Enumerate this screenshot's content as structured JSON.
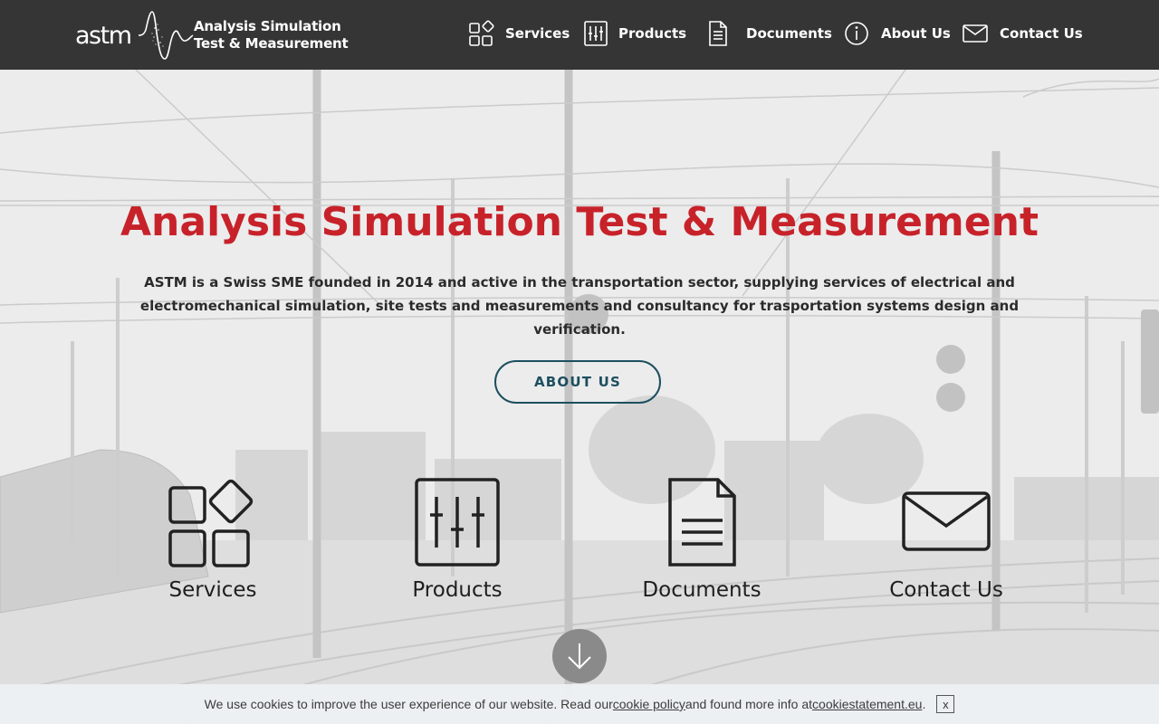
{
  "header": {
    "logo_word": "astm",
    "tagline_line1": "Analysis Simulation",
    "tagline_line2": "Test & Measurement",
    "nav": [
      {
        "label": "Services",
        "icon": "services-grid-icon"
      },
      {
        "label": "Products",
        "icon": "sliders-icon"
      },
      {
        "label": "Documents",
        "icon": "document-icon"
      },
      {
        "label": "About Us",
        "icon": "info-icon"
      },
      {
        "label": "Contact Us",
        "icon": "envelope-icon"
      }
    ]
  },
  "hero": {
    "title": "Analysis Simulation Test & Measurement",
    "description": "ASTM is a Swiss SME founded in 2014 and active in the transportation sector, supplying services of electrical and electromechanical simulation, site tests and measurements and consultancy for trasportation systems design and verification.",
    "about_button": "ABOUT US",
    "title_color": "#c7222a",
    "button_color": "#1d4f5f"
  },
  "tiles": [
    {
      "label": "Services",
      "icon": "services-grid-icon"
    },
    {
      "label": "Products",
      "icon": "sliders-icon"
    },
    {
      "label": "Documents",
      "icon": "document-icon"
    },
    {
      "label": "Contact Us",
      "icon": "envelope-icon"
    }
  ],
  "cookie_bar": {
    "text_before": "We use cookies to improve the user experience of our website. Read our ",
    "policy_link": "cookie policy",
    "text_middle": " and found more info at ",
    "info_link": "cookiestatement.eu",
    "text_after": ".",
    "close": "x"
  },
  "colors": {
    "header_bg": "#353535",
    "accent_red": "#c7222a",
    "accent_teal": "#1d4f5f"
  }
}
